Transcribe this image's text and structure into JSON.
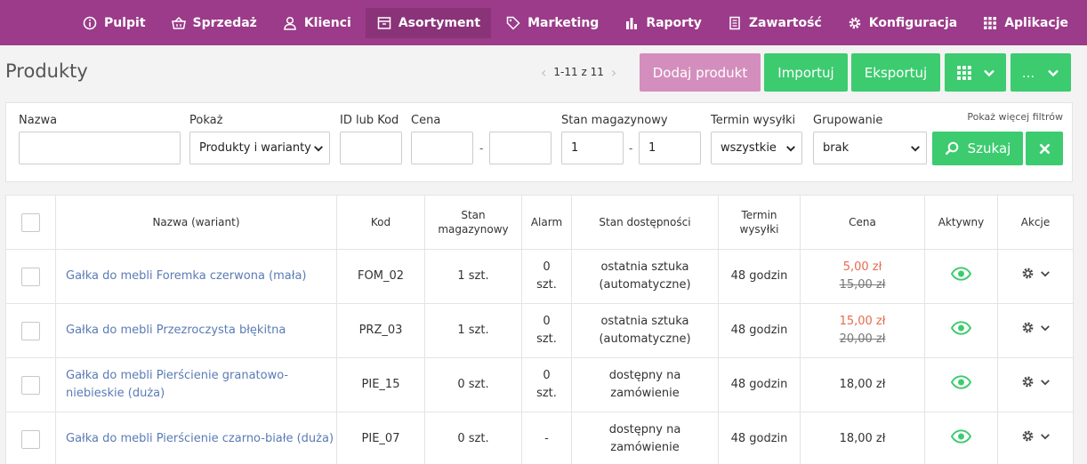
{
  "nav": {
    "items": [
      {
        "label": "Pulpit",
        "icon": "info-circle-icon"
      },
      {
        "label": "Sprzedaż",
        "icon": "basket-icon"
      },
      {
        "label": "Klienci",
        "icon": "users-icon"
      },
      {
        "label": "Asortyment",
        "icon": "box-icon",
        "active": true
      },
      {
        "label": "Marketing",
        "icon": "tag-icon"
      },
      {
        "label": "Raporty",
        "icon": "bar-chart-icon"
      },
      {
        "label": "Zawartość",
        "icon": "document-icon"
      },
      {
        "label": "Konfiguracja",
        "icon": "gear-icon"
      },
      {
        "label": "Aplikacje",
        "icon": "grid-icon"
      }
    ]
  },
  "header": {
    "title": "Produkty",
    "pager": "1-11 z 11",
    "add_label": "Dodaj produkt",
    "import_label": "Importuj",
    "export_label": "Eksportuj",
    "more_label": "..."
  },
  "filters": {
    "name_label": "Nazwa",
    "name_value": "",
    "show_label": "Pokaż",
    "show_value": "Produkty i warianty",
    "id_label": "ID lub Kod",
    "id_value": "",
    "price_label": "Cena",
    "price_from": "",
    "price_to": "",
    "stock_label": "Stan magazynowy",
    "stock_from": "1",
    "stock_to": "1",
    "dash": "-",
    "shipping_label": "Termin wysyłki",
    "shipping_value": "wszystkie",
    "group_label": "Grupowanie",
    "group_value": "brak",
    "more_filters": "Pokaż więcej filtrów",
    "search_label": "Szukaj"
  },
  "table": {
    "headers": {
      "name": "Nazwa (wariant)",
      "code": "Kod",
      "stock_1": "Stan",
      "stock_2": "magazynowy",
      "alarm": "Alarm",
      "availability": "Stan dostępności",
      "shipping_1": "Termin",
      "shipping_2": "wysyłki",
      "price": "Cena",
      "active": "Aktywny",
      "actions": "Akcje"
    },
    "rows": [
      {
        "name": "Gałka do mebli Foremka czerwona (mała)",
        "code": "FOM_02",
        "stock": "1 szt.",
        "alarm_1": "0",
        "alarm_2": "szt.",
        "avail_1": "ostatnia sztuka",
        "avail_2": "(automatyczne)",
        "shipping": "48 godzin",
        "price": "5,00 zł",
        "price_old": "15,00 zł"
      },
      {
        "name": "Gałka do mebli Przezroczysta błękitna",
        "code": "PRZ_03",
        "stock": "1 szt.",
        "alarm_1": "0",
        "alarm_2": "szt.",
        "avail_1": "ostatnia sztuka",
        "avail_2": "(automatyczne)",
        "shipping": "48 godzin",
        "price": "15,00 zł",
        "price_old": "20,00 zł"
      },
      {
        "name_1": "Gałka do mebli Pierścienie granatowo-",
        "name_2": "niebieskie (duża)",
        "code": "PIE_15",
        "stock": "0 szt.",
        "alarm_1": "0",
        "alarm_2": "szt.",
        "avail_1": "dostępny na",
        "avail_2": "zamówienie",
        "shipping": "48 godzin",
        "price": "18,00 zł"
      },
      {
        "name": "Gałka do mebli Pierścienie czarno-białe (duża)",
        "code": "PIE_07",
        "stock": "0 szt.",
        "alarm": "-",
        "avail_1": "dostępny na",
        "avail_2": "zamówienie",
        "shipping": "48 godzin",
        "price": "18,00 zł"
      }
    ]
  },
  "colors": {
    "nav_bg": "#9b3b89",
    "primary_green": "#3ccb6f",
    "add_button": "#d48ebd",
    "link": "#5a7bb5",
    "sale_price": "#e86a4e"
  }
}
